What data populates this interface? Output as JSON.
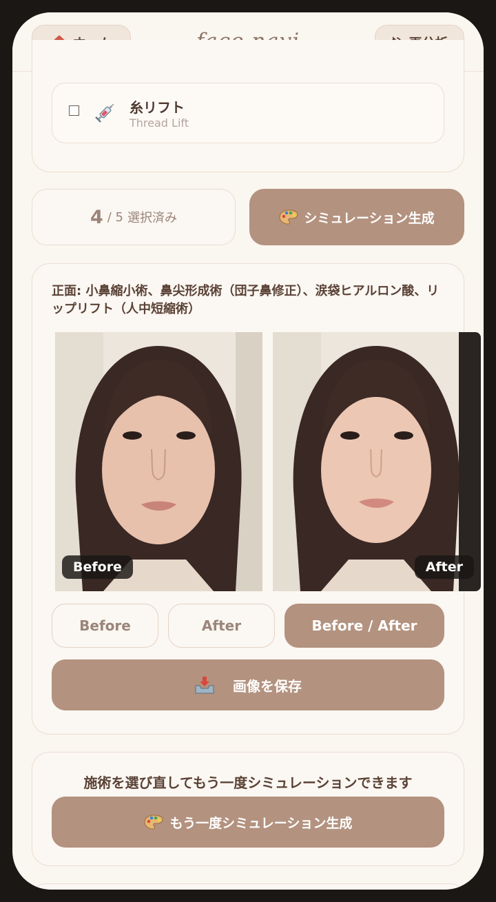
{
  "header": {
    "home_label": "ホーム",
    "logo": "face navi",
    "reanalyze_label": "再分析"
  },
  "treatment_item": {
    "name_ja": "糸リフト",
    "name_en": "Thread Lift",
    "checked": false
  },
  "selection": {
    "count": "4",
    "total": "/ 5",
    "suffix": "選択済み",
    "generate_label": "シミュレーション生成"
  },
  "result": {
    "label": "正面: 小鼻縮小術、鼻尖形成術（団子鼻修正）、涙袋ヒアルロン酸、リップリフト（人中短縮術）",
    "before_badge": "Before",
    "after_badge": "After",
    "view_modes": [
      "Before",
      "After",
      "Before / After"
    ],
    "active_mode": "Before / After",
    "save_label": "画像を保存"
  },
  "retry": {
    "text": "施術を選び直してもう一度シミュレーションできます",
    "button_label": "もう一度シミュレーション生成"
  },
  "colors": {
    "accent": "#b3927f",
    "text": "#5a4236",
    "background": "#faf6f0",
    "border": "#eaded2"
  },
  "icons": {
    "home": "house-icon",
    "reanalyze": "refresh-icon",
    "treatment": "syringe-icon",
    "generate": "palette-icon",
    "save": "inbox-tray-icon"
  }
}
